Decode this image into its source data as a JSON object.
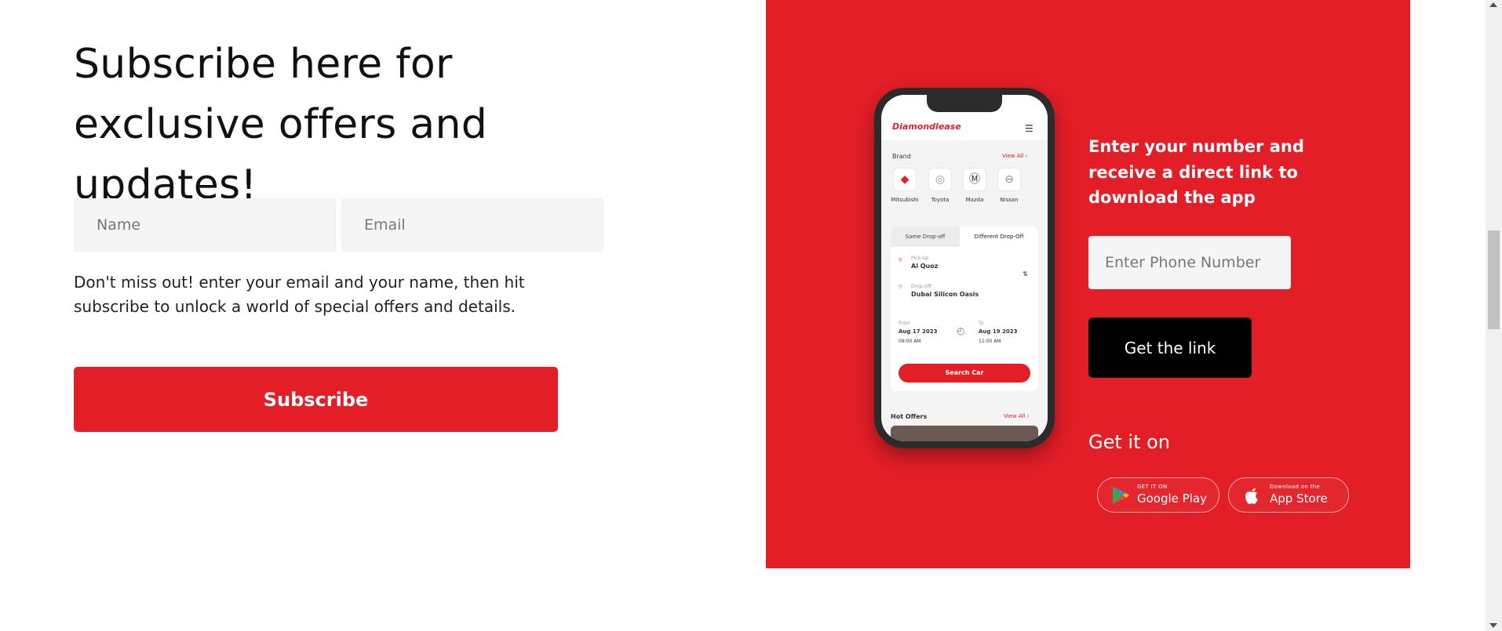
{
  "subscribe": {
    "title": "Subscribe here for exclusive offers and updates!",
    "name_placeholder": "Name",
    "email_placeholder": "Email",
    "description": "Don't miss out! enter your email and your name, then hit subscribe to unlock a world of special offers and details.",
    "button_label": "Subscribe"
  },
  "app_panel": {
    "colors": {
      "panel": "#e31e27",
      "link_button": "#000000"
    },
    "download_text": "Enter your number and receive a direct link to download the app",
    "phone_placeholder": "Enter Phone Number",
    "link_button_label": "Get the link",
    "get_it_on": "Get it on",
    "google_play": {
      "small": "GET IT ON",
      "big": "Google Play",
      "icon": "google-play-icon"
    },
    "app_store": {
      "small": "Download on the",
      "big": "App Store",
      "icon": "apple-icon"
    }
  },
  "phone_mockup": {
    "logo": "Diamondlease",
    "brand_heading": "Brand",
    "view_all": "View All ›",
    "brands": [
      "Mitsubishi",
      "Toyota",
      "Mazda",
      "Nissan"
    ],
    "tabs": [
      "Same Drop-off",
      "Different Drop-Off"
    ],
    "pickup_label": "Pick-Up",
    "pickup_value": "Al Quoz",
    "dropoff_label": "Drop-Off",
    "dropoff_value": "Dubai Silicon Oasis",
    "from_label": "From",
    "from_date": "Aug 17 2023",
    "from_time": "09:00 AM",
    "to_label": "To",
    "to_date": "Aug 19 2023",
    "to_time": "11:00 AM",
    "search_button": "Search Car",
    "hot_offers": "Hot Offers",
    "hot_view_all": "View All ›"
  }
}
